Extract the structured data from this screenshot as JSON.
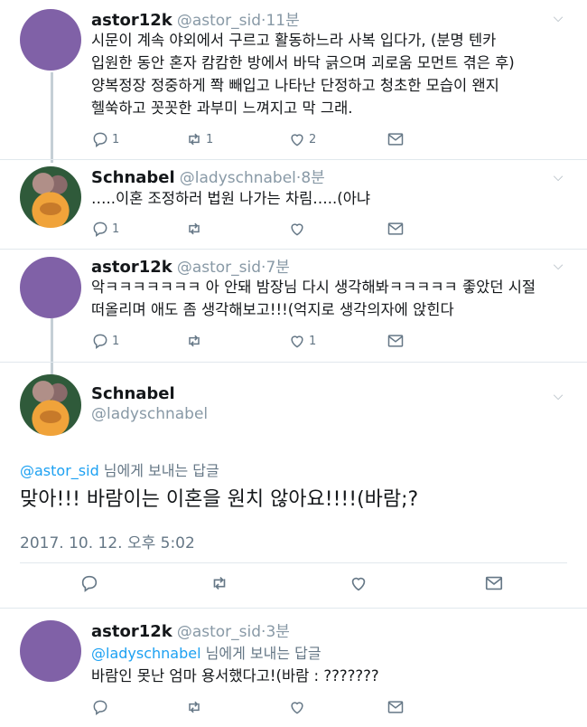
{
  "tweets": [
    {
      "name": "astor12k",
      "handle": "@astor_sid",
      "time": "11분",
      "lines": [
        "시문이 계속 야외에서 구르고 활동하느라 사복 입다가, (분명 텐카",
        "입원한 동안 혼자 캄캄한 방에서 바닥 긁으며 괴로움 모먼트 겪은 후)",
        "양복정장 정중하게 쫙 빼입고 나타난 단정하고 청초한 모습이 왠지",
        "헬쑥하고 꼿꼿한 과부미 느껴지고 막 그래."
      ],
      "reply_count": "1",
      "retweet_count": "1",
      "like_count": "2"
    },
    {
      "name": "Schnabel",
      "handle": "@ladyschnabel",
      "time": "8분",
      "lines": [
        "…..이혼 조정하러 법원 나가는 차림…..(아냐"
      ],
      "reply_count": "1",
      "retweet_count": "",
      "like_count": ""
    },
    {
      "name": "astor12k",
      "handle": "@astor_sid",
      "time": "7분",
      "lines": [
        "악ㅋㅋㅋㅋㅋㅋㅋ 아 안돼 밤장님 다시 생각해봐ㅋㅋㅋㅋㅋ 좋았던 시절",
        "떠올리며 애도 좀 생각해보고!!!(억지로 생각의자에 앉힌다"
      ],
      "reply_count": "1",
      "retweet_count": "",
      "like_count": "1"
    }
  ],
  "focused": {
    "name": "Schnabel",
    "handle": "@ladyschnabel",
    "replying_mention": "@astor_sid",
    "replying_suffix": " 님에게 보내는 답글",
    "text": "맞아!!! 바람이는 이혼을 원치 않아요!!!!(바람;?",
    "date": "2017. 10. 12. 오후 5:02"
  },
  "reply": {
    "name": "astor12k",
    "handle": "@astor_sid",
    "time": "3분",
    "replying_mention": "@ladyschnabel",
    "replying_suffix": " 님에게 보내는 답글",
    "text": "바람인 못난 엄마 용서했다고!(바람 : ???????"
  },
  "sep": "·",
  "colors": {
    "accent": "#1da1f2",
    "avatar_purple": "#8061a7",
    "muted": "#657786"
  },
  "icons": [
    "reply-icon",
    "retweet-icon",
    "like-icon",
    "message-icon",
    "chevron-down-icon"
  ]
}
